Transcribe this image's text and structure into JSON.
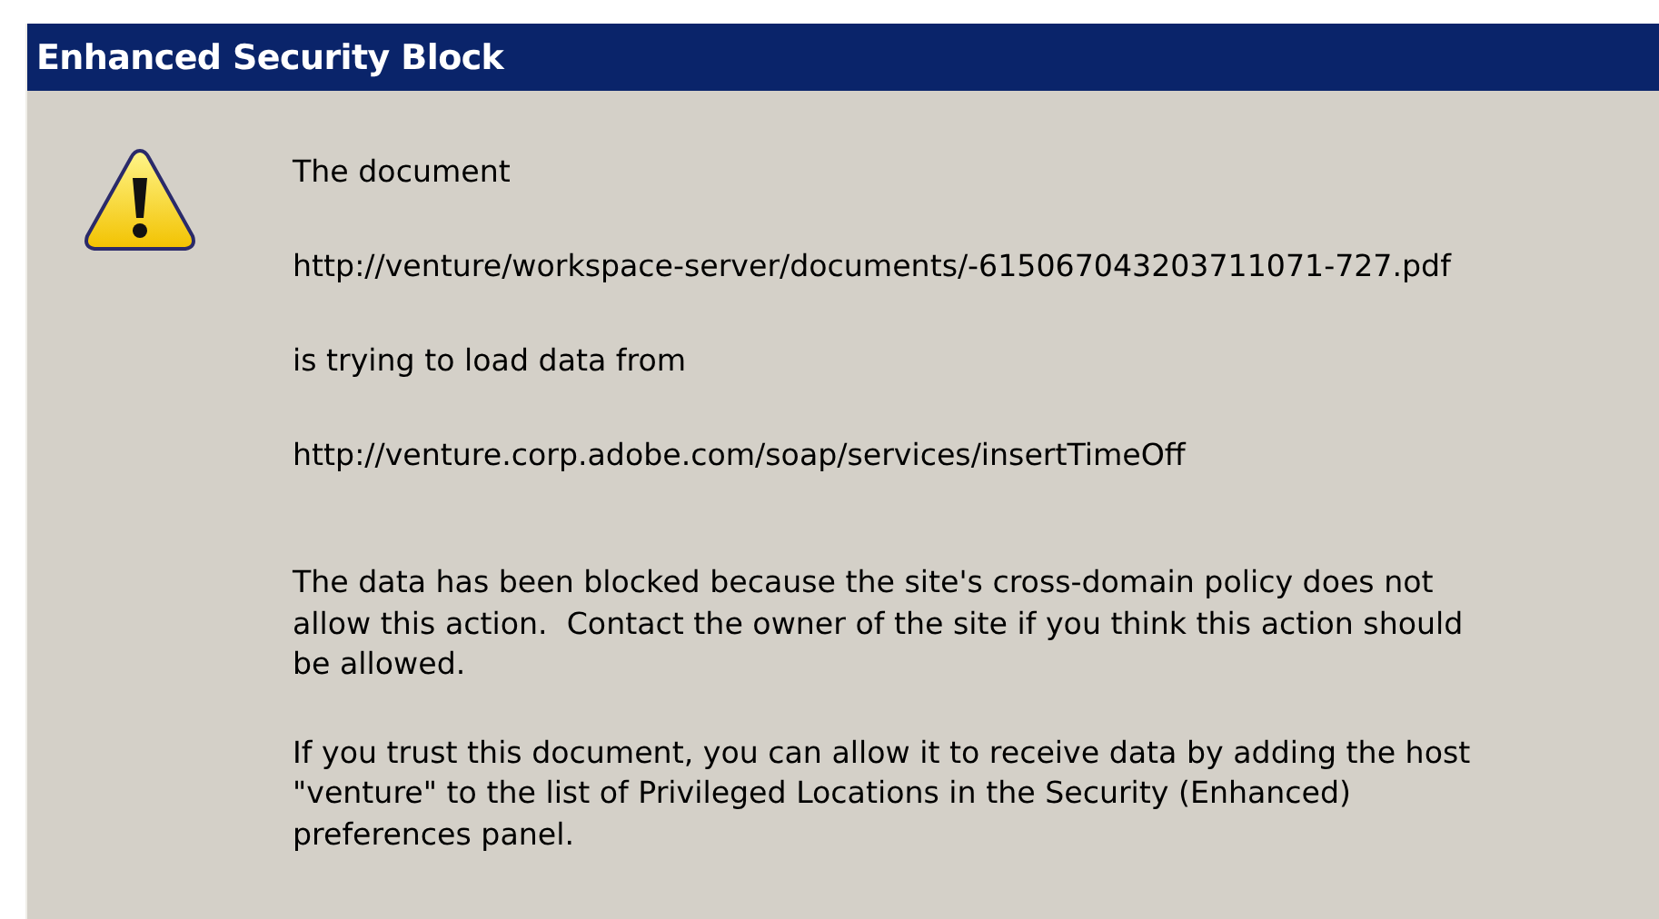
{
  "window": {
    "title": "Enhanced Security Block"
  },
  "messages": [
    {
      "kind": "short",
      "text": "The document"
    },
    {
      "kind": "short",
      "text": "http://venture/workspace-server/documents/-615067043203711071-727.pdf"
    },
    {
      "kind": "short",
      "text": "is trying to load data from"
    },
    {
      "kind": "short",
      "text": "http://venture.corp.adobe.com/soap/services/insertTimeOff"
    },
    {
      "kind": "paragraph",
      "text": "The data has been blocked because the site's cross-domain policy does not\nallow this action.  Contact the owner of the site if you think this action should\nbe allowed."
    },
    {
      "kind": "paragraph",
      "text": "If you trust this document, you can allow it to receive data by adding the host\n\"venture\" to the list of Privileged Locations in the Security (Enhanced)\npreferences panel."
    }
  ]
}
